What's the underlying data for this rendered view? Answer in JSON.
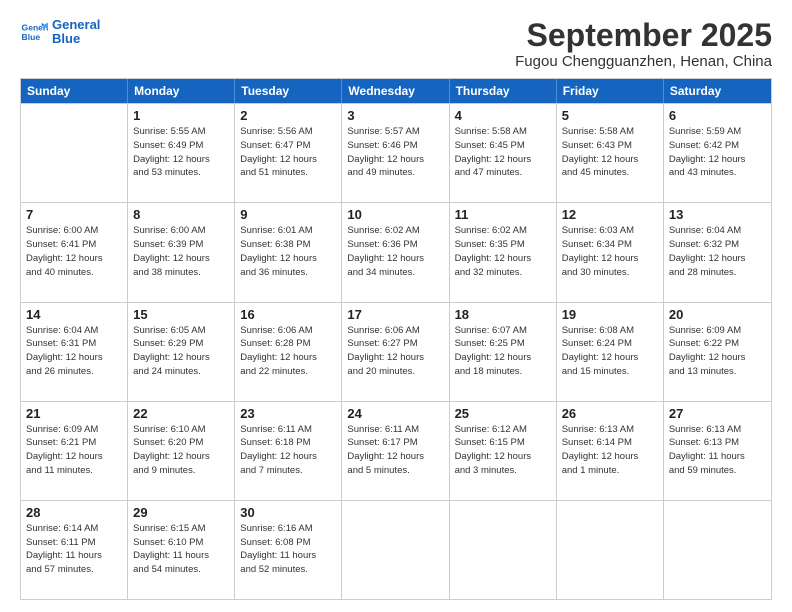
{
  "logo": {
    "line1": "General",
    "line2": "Blue"
  },
  "title": "September 2025",
  "subtitle": "Fugou Chengguanzhen, Henan, China",
  "header_days": [
    "Sunday",
    "Monday",
    "Tuesday",
    "Wednesday",
    "Thursday",
    "Friday",
    "Saturday"
  ],
  "weeks": [
    [
      {
        "day": "",
        "info": ""
      },
      {
        "day": "1",
        "info": "Sunrise: 5:55 AM\nSunset: 6:49 PM\nDaylight: 12 hours\nand 53 minutes."
      },
      {
        "day": "2",
        "info": "Sunrise: 5:56 AM\nSunset: 6:47 PM\nDaylight: 12 hours\nand 51 minutes."
      },
      {
        "day": "3",
        "info": "Sunrise: 5:57 AM\nSunset: 6:46 PM\nDaylight: 12 hours\nand 49 minutes."
      },
      {
        "day": "4",
        "info": "Sunrise: 5:58 AM\nSunset: 6:45 PM\nDaylight: 12 hours\nand 47 minutes."
      },
      {
        "day": "5",
        "info": "Sunrise: 5:58 AM\nSunset: 6:43 PM\nDaylight: 12 hours\nand 45 minutes."
      },
      {
        "day": "6",
        "info": "Sunrise: 5:59 AM\nSunset: 6:42 PM\nDaylight: 12 hours\nand 43 minutes."
      }
    ],
    [
      {
        "day": "7",
        "info": "Sunrise: 6:00 AM\nSunset: 6:41 PM\nDaylight: 12 hours\nand 40 minutes."
      },
      {
        "day": "8",
        "info": "Sunrise: 6:00 AM\nSunset: 6:39 PM\nDaylight: 12 hours\nand 38 minutes."
      },
      {
        "day": "9",
        "info": "Sunrise: 6:01 AM\nSunset: 6:38 PM\nDaylight: 12 hours\nand 36 minutes."
      },
      {
        "day": "10",
        "info": "Sunrise: 6:02 AM\nSunset: 6:36 PM\nDaylight: 12 hours\nand 34 minutes."
      },
      {
        "day": "11",
        "info": "Sunrise: 6:02 AM\nSunset: 6:35 PM\nDaylight: 12 hours\nand 32 minutes."
      },
      {
        "day": "12",
        "info": "Sunrise: 6:03 AM\nSunset: 6:34 PM\nDaylight: 12 hours\nand 30 minutes."
      },
      {
        "day": "13",
        "info": "Sunrise: 6:04 AM\nSunset: 6:32 PM\nDaylight: 12 hours\nand 28 minutes."
      }
    ],
    [
      {
        "day": "14",
        "info": "Sunrise: 6:04 AM\nSunset: 6:31 PM\nDaylight: 12 hours\nand 26 minutes."
      },
      {
        "day": "15",
        "info": "Sunrise: 6:05 AM\nSunset: 6:29 PM\nDaylight: 12 hours\nand 24 minutes."
      },
      {
        "day": "16",
        "info": "Sunrise: 6:06 AM\nSunset: 6:28 PM\nDaylight: 12 hours\nand 22 minutes."
      },
      {
        "day": "17",
        "info": "Sunrise: 6:06 AM\nSunset: 6:27 PM\nDaylight: 12 hours\nand 20 minutes."
      },
      {
        "day": "18",
        "info": "Sunrise: 6:07 AM\nSunset: 6:25 PM\nDaylight: 12 hours\nand 18 minutes."
      },
      {
        "day": "19",
        "info": "Sunrise: 6:08 AM\nSunset: 6:24 PM\nDaylight: 12 hours\nand 15 minutes."
      },
      {
        "day": "20",
        "info": "Sunrise: 6:09 AM\nSunset: 6:22 PM\nDaylight: 12 hours\nand 13 minutes."
      }
    ],
    [
      {
        "day": "21",
        "info": "Sunrise: 6:09 AM\nSunset: 6:21 PM\nDaylight: 12 hours\nand 11 minutes."
      },
      {
        "day": "22",
        "info": "Sunrise: 6:10 AM\nSunset: 6:20 PM\nDaylight: 12 hours\nand 9 minutes."
      },
      {
        "day": "23",
        "info": "Sunrise: 6:11 AM\nSunset: 6:18 PM\nDaylight: 12 hours\nand 7 minutes."
      },
      {
        "day": "24",
        "info": "Sunrise: 6:11 AM\nSunset: 6:17 PM\nDaylight: 12 hours\nand 5 minutes."
      },
      {
        "day": "25",
        "info": "Sunrise: 6:12 AM\nSunset: 6:15 PM\nDaylight: 12 hours\nand 3 minutes."
      },
      {
        "day": "26",
        "info": "Sunrise: 6:13 AM\nSunset: 6:14 PM\nDaylight: 12 hours\nand 1 minute."
      },
      {
        "day": "27",
        "info": "Sunrise: 6:13 AM\nSunset: 6:13 PM\nDaylight: 11 hours\nand 59 minutes."
      }
    ],
    [
      {
        "day": "28",
        "info": "Sunrise: 6:14 AM\nSunset: 6:11 PM\nDaylight: 11 hours\nand 57 minutes."
      },
      {
        "day": "29",
        "info": "Sunrise: 6:15 AM\nSunset: 6:10 PM\nDaylight: 11 hours\nand 54 minutes."
      },
      {
        "day": "30",
        "info": "Sunrise: 6:16 AM\nSunset: 6:08 PM\nDaylight: 11 hours\nand 52 minutes."
      },
      {
        "day": "",
        "info": ""
      },
      {
        "day": "",
        "info": ""
      },
      {
        "day": "",
        "info": ""
      },
      {
        "day": "",
        "info": ""
      }
    ]
  ]
}
